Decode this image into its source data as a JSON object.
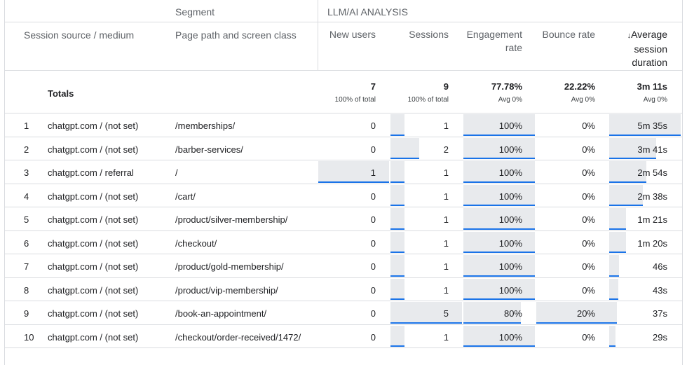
{
  "header": {
    "segment_label": "Segment",
    "segment_value": "LLM/AI ANALYSIS",
    "columns": {
      "source": "Session source / medium",
      "path": "Page path and screen class",
      "new_users": "New users",
      "sessions": "Sessions",
      "engagement_line1": "Engagement",
      "engagement_line2": "rate",
      "bounce": "Bounce rate",
      "duration_line1": "Average",
      "duration_line2": "session",
      "duration_line3": "duration",
      "sort_icon": "↓"
    }
  },
  "totals": {
    "label": "Totals",
    "new_users": "7",
    "new_users_sub": "100% of total",
    "sessions": "9",
    "sessions_sub": "100% of total",
    "engagement": "77.78%",
    "engagement_sub": "Avg 0%",
    "bounce": "22.22%",
    "bounce_sub": "Avg 0%",
    "duration": "3m 11s",
    "duration_sub": "Avg 0%"
  },
  "rows": [
    {
      "idx": "1",
      "source": "chatgpt.com / (not set)",
      "path": "/memberships/",
      "new_users": "0",
      "sessions": "1",
      "engagement": "100%",
      "bounce": "0%",
      "duration": "5m 35s",
      "nu_frac": 0,
      "s_frac": 0.2,
      "e_frac": 1,
      "b_frac": 0,
      "d_frac": 1
    },
    {
      "idx": "2",
      "source": "chatgpt.com / (not set)",
      "path": "/barber-services/",
      "new_users": "0",
      "sessions": "2",
      "engagement": "100%",
      "bounce": "0%",
      "duration": "3m 41s",
      "nu_frac": 0,
      "s_frac": 0.4,
      "e_frac": 1,
      "b_frac": 0,
      "d_frac": 0.66
    },
    {
      "idx": "3",
      "source": "chatgpt.com / referral",
      "path": "/",
      "new_users": "1",
      "sessions": "1",
      "engagement": "100%",
      "bounce": "0%",
      "duration": "2m 54s",
      "nu_frac": 1,
      "s_frac": 0.2,
      "e_frac": 1,
      "b_frac": 0,
      "d_frac": 0.52
    },
    {
      "idx": "4",
      "source": "chatgpt.com / (not set)",
      "path": "/cart/",
      "new_users": "0",
      "sessions": "1",
      "engagement": "100%",
      "bounce": "0%",
      "duration": "2m 38s",
      "nu_frac": 0,
      "s_frac": 0.2,
      "e_frac": 1,
      "b_frac": 0,
      "d_frac": 0.47
    },
    {
      "idx": "5",
      "source": "chatgpt.com / (not set)",
      "path": "/product/silver-membership/",
      "new_users": "0",
      "sessions": "1",
      "engagement": "100%",
      "bounce": "0%",
      "duration": "1m 21s",
      "nu_frac": 0,
      "s_frac": 0.2,
      "e_frac": 1,
      "b_frac": 0,
      "d_frac": 0.24
    },
    {
      "idx": "6",
      "source": "chatgpt.com / (not set)",
      "path": "/checkout/",
      "new_users": "0",
      "sessions": "1",
      "engagement": "100%",
      "bounce": "0%",
      "duration": "1m 20s",
      "nu_frac": 0,
      "s_frac": 0.2,
      "e_frac": 1,
      "b_frac": 0,
      "d_frac": 0.24
    },
    {
      "idx": "7",
      "source": "chatgpt.com / (not set)",
      "path": "/product/gold-membership/",
      "new_users": "0",
      "sessions": "1",
      "engagement": "100%",
      "bounce": "0%",
      "duration": "46s",
      "nu_frac": 0,
      "s_frac": 0.2,
      "e_frac": 1,
      "b_frac": 0,
      "d_frac": 0.14
    },
    {
      "idx": "8",
      "source": "chatgpt.com / (not set)",
      "path": "/product/vip-membership/",
      "new_users": "0",
      "sessions": "1",
      "engagement": "100%",
      "bounce": "0%",
      "duration": "43s",
      "nu_frac": 0,
      "s_frac": 0.2,
      "e_frac": 1,
      "b_frac": 0,
      "d_frac": 0.13
    },
    {
      "idx": "9",
      "source": "chatgpt.com / (not set)",
      "path": "/book-an-appointment/",
      "new_users": "0",
      "sessions": "5",
      "engagement": "80%",
      "bounce": "20%",
      "duration": "37s",
      "nu_frac": 0,
      "s_frac": 1,
      "e_frac": 0.8,
      "b_frac": 1,
      "d_frac": 0.11
    },
    {
      "idx": "10",
      "source": "chatgpt.com / (not set)",
      "path": "/checkout/order-received/1472/",
      "new_users": "0",
      "sessions": "1",
      "engagement": "100%",
      "bounce": "0%",
      "duration": "29s",
      "nu_frac": 0,
      "s_frac": 0.2,
      "e_frac": 1,
      "b_frac": 0,
      "d_frac": 0.09
    }
  ]
}
